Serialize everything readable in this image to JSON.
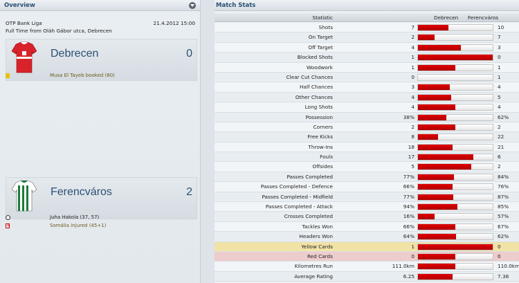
{
  "overview": {
    "title": "Overview",
    "competition": "OTP Bank Liga",
    "date_time": "21.4.2012 15:00",
    "venue_line": "Full Time from Oláh Gábor utca, Debrecen",
    "home": {
      "name": "Debrecen",
      "score": "0",
      "shirt_color": "#d8232a",
      "events": [
        {
          "icon": "yellow-card-icon",
          "text": "Musa El Tayeb booked (80)"
        }
      ]
    },
    "away": {
      "name": "Ferencváros",
      "score": "2",
      "shirt_color": "#1e7a3a",
      "events": [
        {
          "icon": "ball-icon",
          "text": "Juha Hakola (37, 57)"
        },
        {
          "icon": "injury-icon",
          "text": "Somália injured (45+1)"
        }
      ]
    }
  },
  "match_stats": {
    "title": "Match Stats",
    "columns": {
      "statistic": "Statistic",
      "home": "Debrecen",
      "away": "Ferencváros"
    },
    "bar_color": "#c80000",
    "rows": [
      {
        "stat": "Shots",
        "home": "7",
        "away": "10",
        "home_share": 0.41
      },
      {
        "stat": "On Target",
        "home": "2",
        "away": "7",
        "home_share": 0.22
      },
      {
        "stat": "Off Target",
        "home": "4",
        "away": "3",
        "home_share": 0.57
      },
      {
        "stat": "Blocked Shots",
        "home": "1",
        "away": "0",
        "home_share": 1.0
      },
      {
        "stat": "Woodwork",
        "home": "1",
        "away": "1",
        "home_share": 0.5
      },
      {
        "stat": "Clear Cut Chances",
        "home": "0",
        "away": "1",
        "home_share": 0.0
      },
      {
        "stat": "Half Chances",
        "home": "3",
        "away": "4",
        "home_share": 0.43
      },
      {
        "stat": "Other Chances",
        "home": "4",
        "away": "5",
        "home_share": 0.44
      },
      {
        "stat": "Long Shots",
        "home": "4",
        "away": "4",
        "home_share": 0.5
      },
      {
        "stat": "Possession",
        "home": "38%",
        "away": "62%",
        "home_share": 0.38
      },
      {
        "stat": "Corners",
        "home": "2",
        "away": "2",
        "home_share": 0.5
      },
      {
        "stat": "Free Kicks",
        "home": "8",
        "away": "22",
        "home_share": 0.27
      },
      {
        "stat": "Throw-Ins",
        "home": "18",
        "away": "21",
        "home_share": 0.46
      },
      {
        "stat": "Fouls",
        "home": "17",
        "away": "6",
        "home_share": 0.74
      },
      {
        "stat": "Offsides",
        "home": "5",
        "away": "2",
        "home_share": 0.71
      },
      {
        "stat": "Passes Completed",
        "home": "77%",
        "away": "84%",
        "home_share": 0.48
      },
      {
        "stat": "Passes Completed - Defence",
        "home": "66%",
        "away": "76%",
        "home_share": 0.46
      },
      {
        "stat": "Passes Completed - Midfield",
        "home": "77%",
        "away": "87%",
        "home_share": 0.47
      },
      {
        "stat": "Passes Completed - Attack",
        "home": "94%",
        "away": "85%",
        "home_share": 0.53
      },
      {
        "stat": "Crosses Completed",
        "home": "16%",
        "away": "57%",
        "home_share": 0.22
      },
      {
        "stat": "Tackles Won",
        "home": "66%",
        "away": "67%",
        "home_share": 0.5
      },
      {
        "stat": "Headers Won",
        "home": "64%",
        "away": "62%",
        "home_share": 0.51
      },
      {
        "stat": "Yellow Cards",
        "home": "1",
        "away": "0",
        "home_share": 1.0,
        "highlight": "yellow"
      },
      {
        "stat": "Red Cards",
        "home": "0",
        "away": "0",
        "home_share": 0.5,
        "highlight": "red"
      },
      {
        "stat": "Kilometres Run",
        "home": "111.0km",
        "away": "110.0km",
        "home_share": 0.5
      },
      {
        "stat": "Average Rating",
        "home": "6.25",
        "away": "7.38",
        "home_share": 0.46
      }
    ]
  }
}
